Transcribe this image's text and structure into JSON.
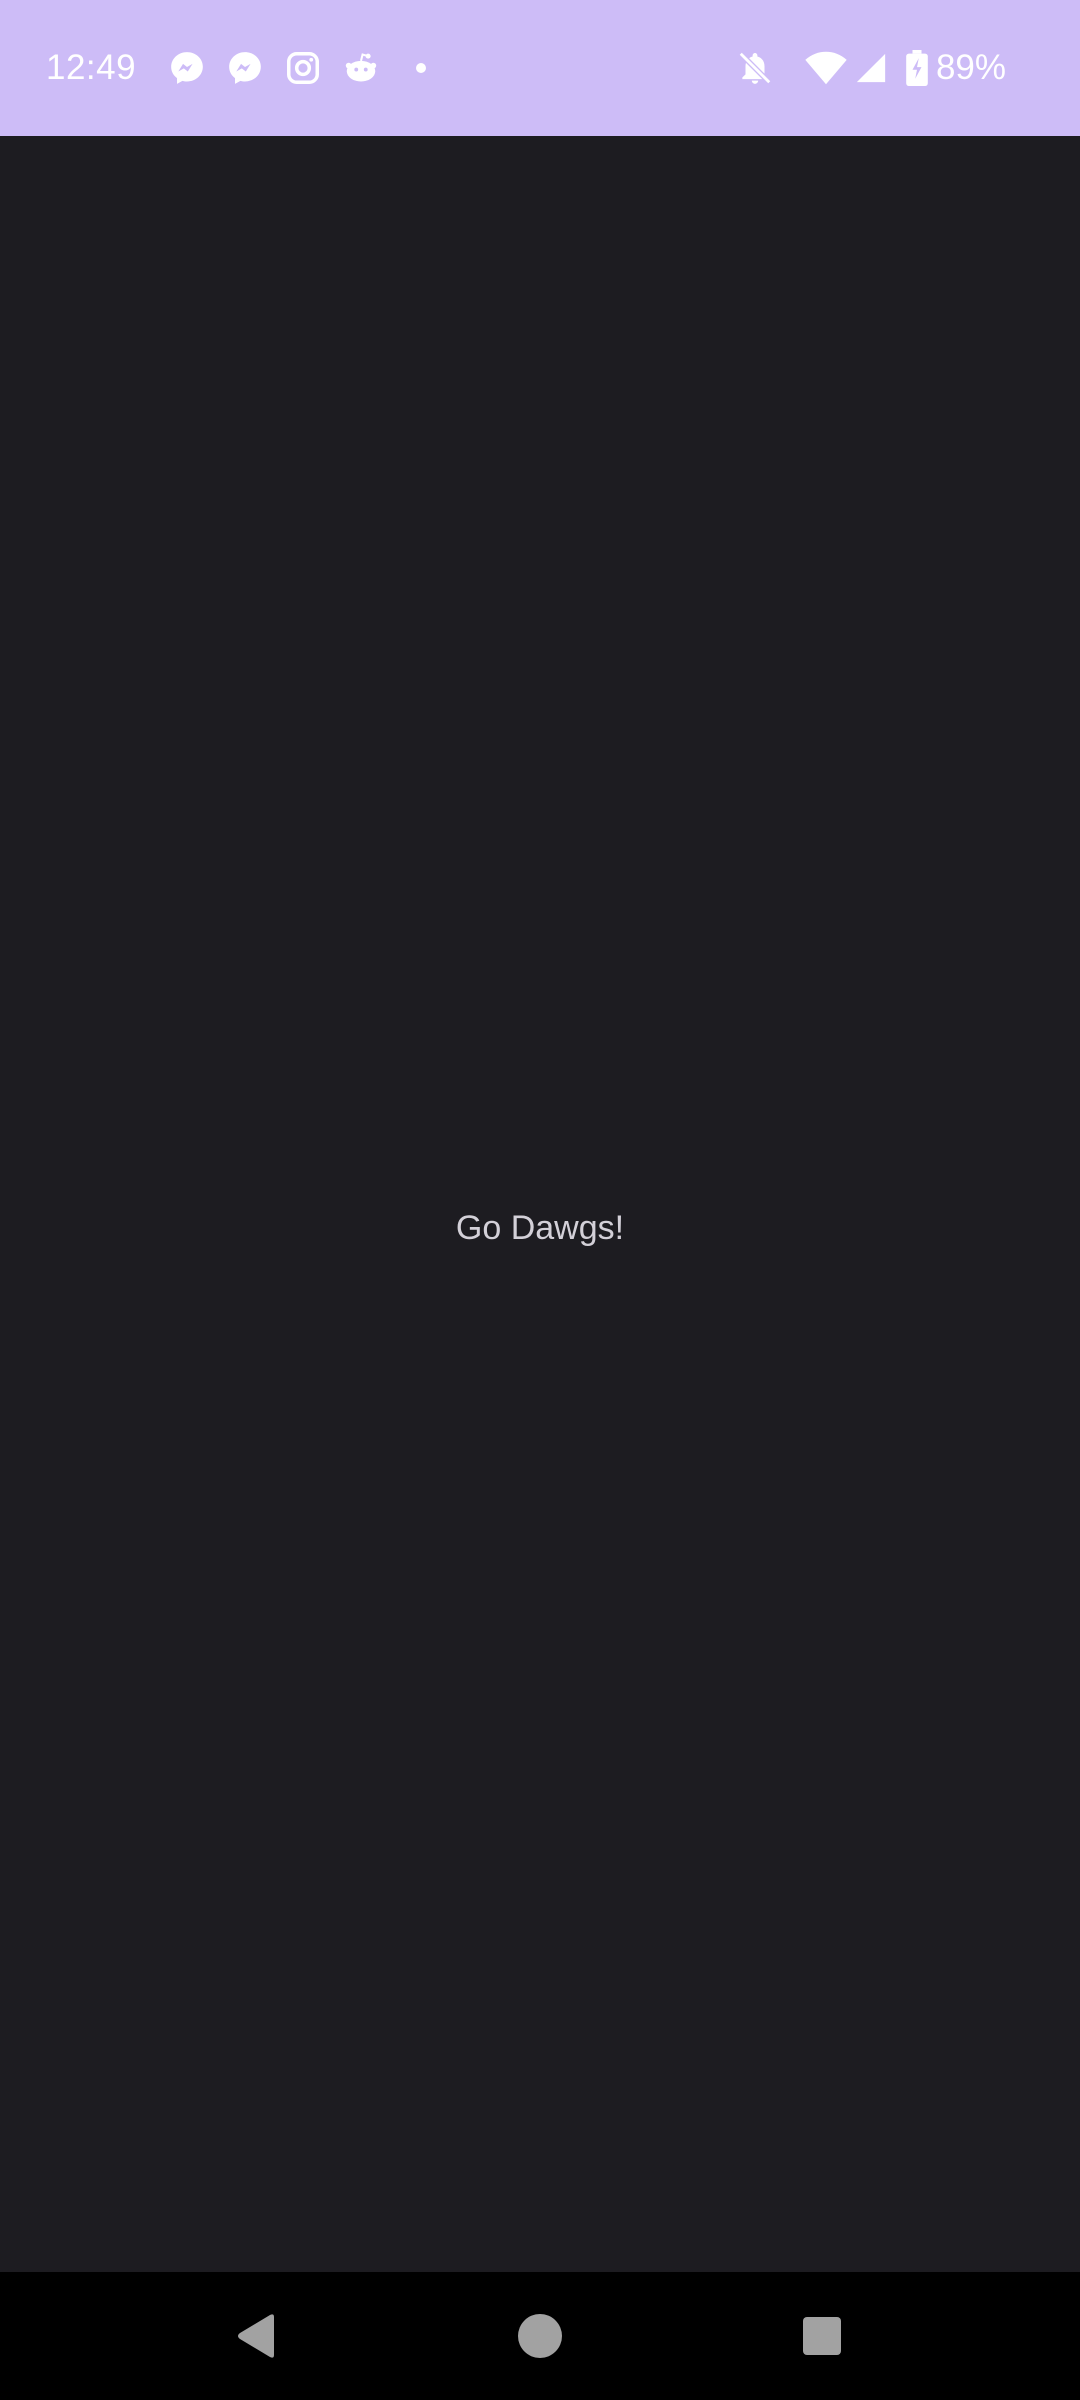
{
  "status_bar": {
    "time": "12:49",
    "notifications": [
      "messenger-icon",
      "messenger-icon",
      "instagram-icon",
      "reddit-icon",
      "more-dot-icon"
    ],
    "system_icons": [
      "notifications-off-icon",
      "wifi-icon",
      "cell-signal-icon",
      "battery-charging-icon"
    ],
    "battery_percent": "89%",
    "background_color": "#cdbcf7"
  },
  "main": {
    "message": "Go Dawgs!",
    "background_color": "#1d1c21"
  },
  "nav_bar": {
    "buttons": [
      "back-icon",
      "home-icon",
      "recents-icon"
    ]
  }
}
